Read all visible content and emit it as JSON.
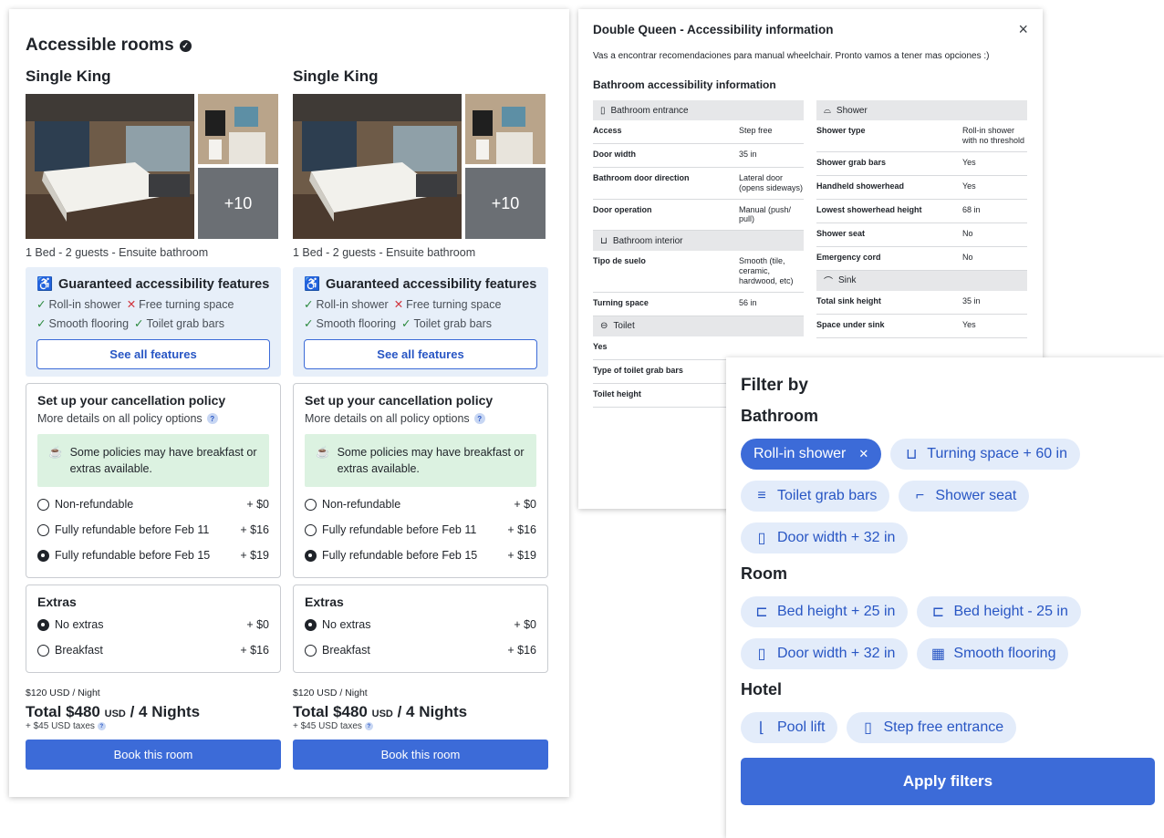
{
  "rooms_panel": {
    "title": "Accessible rooms",
    "rooms": [
      {
        "name": "Single King",
        "more_photos": "+10",
        "subtitle": "1 Bed - 2 guests - Ensuite bathroom",
        "accessibility": {
          "title": "Guaranteed accessibility features",
          "features_row1": [
            {
              "mark": "✓",
              "label": "Roll-in shower",
              "ok": true
            },
            {
              "mark": "✕",
              "label": "Free turning space",
              "ok": false
            }
          ],
          "features_row2": [
            {
              "mark": "✓",
              "label": "Smooth flooring",
              "ok": true
            },
            {
              "mark": "✓",
              "label": "Toilet grab bars",
              "ok": true
            }
          ],
          "button": "See all features"
        },
        "cancellation": {
          "title": "Set up your cancellation policy",
          "subtitle": "More details on all policy options",
          "note": "Some policies may have breakfast or extras available.",
          "options": [
            {
              "label": "Non-refundable",
              "price": "+ $0",
              "selected": false
            },
            {
              "label": "Fully refundable before Feb 11",
              "price": "+ $16",
              "selected": false
            },
            {
              "label": "Fully refundable before Feb 15",
              "price": "+ $19",
              "selected": true
            }
          ]
        },
        "extras": {
          "title": "Extras",
          "options": [
            {
              "label": "No extras",
              "price": "+ $0",
              "selected": true
            },
            {
              "label": "Breakfast",
              "price": "+ $16",
              "selected": false
            }
          ]
        },
        "price_night": "$120 USD / Night",
        "total_amount": "Total $480",
        "total_currency": "USD",
        "total_suffix": "/ 4 Nights",
        "taxes": "+ $45 USD taxes",
        "book": "Book this room"
      },
      {
        "name": "Single King",
        "more_photos": "+10",
        "subtitle": "1 Bed - 2 guests - Ensuite bathroom",
        "accessibility": {
          "title": "Guaranteed accessibility features",
          "features_row1": [
            {
              "mark": "✓",
              "label": "Roll-in shower",
              "ok": true
            },
            {
              "mark": "✕",
              "label": "Free turning space",
              "ok": false
            }
          ],
          "features_row2": [
            {
              "mark": "✓",
              "label": "Smooth flooring",
              "ok": true
            },
            {
              "mark": "✓",
              "label": "Toilet grab bars",
              "ok": true
            }
          ],
          "button": "See all features"
        },
        "cancellation": {
          "title": "Set up your cancellation policy",
          "subtitle": "More details on all policy options",
          "note": "Some policies may have breakfast or extras available.",
          "options": [
            {
              "label": "Non-refundable",
              "price": "+ $0",
              "selected": false
            },
            {
              "label": "Fully refundable before Feb 11",
              "price": "+ $16",
              "selected": false
            },
            {
              "label": "Fully refundable before Feb 15",
              "price": "+ $19",
              "selected": true
            }
          ]
        },
        "extras": {
          "title": "Extras",
          "options": [
            {
              "label": "No extras",
              "price": "+ $0",
              "selected": true
            },
            {
              "label": "Breakfast",
              "price": "+ $16",
              "selected": false
            }
          ]
        },
        "price_night": "$120 USD / Night",
        "total_amount": "Total $480",
        "total_currency": "USD",
        "total_suffix": "/ 4 Nights",
        "taxes": "+ $45 USD taxes",
        "book": "Book this room"
      }
    ]
  },
  "info_panel": {
    "title": "Double Queen - Accessibility information",
    "note": "Vas a encontrar recomendaciones para manual wheelchair. Pronto vamos a tener mas opciones :)",
    "section_title": "Bathroom accessibility information",
    "left_sections": [
      {
        "title": "Bathroom entrance",
        "icon": "door-icon",
        "rows": [
          {
            "k": "Access",
            "v": "Step free"
          },
          {
            "k": "Door width",
            "v": "35 in"
          },
          {
            "k": "Bathroom door direction",
            "v": "Lateral door (opens sideways)"
          },
          {
            "k": "Door operation",
            "v": "Manual (push/ pull)"
          }
        ]
      },
      {
        "title": "Bathroom interior",
        "icon": "turning-space-icon",
        "rows": [
          {
            "k": "Tipo de suelo",
            "v": "Smooth (tile, ceramic, hardwood, etc)"
          },
          {
            "k": "Turning space",
            "v": "56 in"
          }
        ]
      },
      {
        "title": "Toilet",
        "icon": "toilet-icon",
        "rows": [
          {
            "k": "Yes",
            "v": ""
          },
          {
            "k": "Type of toilet grab bars",
            "v": ""
          },
          {
            "k": "Toilet height",
            "v": ""
          }
        ]
      }
    ],
    "right_sections": [
      {
        "title": "Shower",
        "icon": "shower-icon",
        "rows": [
          {
            "k": "Shower type",
            "v": "Roll-in shower with no threshold"
          },
          {
            "k": "Shower grab bars",
            "v": "Yes"
          },
          {
            "k": "Handheld showerhead",
            "v": "Yes"
          },
          {
            "k": "Lowest showerhead height",
            "v": "68 in"
          },
          {
            "k": "Shower seat",
            "v": "No"
          },
          {
            "k": "Emergency cord",
            "v": "No"
          }
        ]
      },
      {
        "title": "Sink",
        "icon": "sink-icon",
        "rows": [
          {
            "k": "Total sink height",
            "v": "35 in"
          },
          {
            "k": "Space under sink",
            "v": "Yes"
          }
        ]
      }
    ]
  },
  "filter_panel": {
    "title": "Filter by",
    "sections": [
      {
        "title": "Bathroom",
        "chips": [
          {
            "label": "Roll-in shower",
            "selected": true,
            "icon": ""
          },
          {
            "label": "Turning space + 60 in",
            "selected": false,
            "icon": "turning-space-icon"
          },
          {
            "label": "Toilet grab bars",
            "selected": false,
            "icon": "grab-bars-icon"
          },
          {
            "label": "Shower seat",
            "selected": false,
            "icon": "shower-seat-icon"
          },
          {
            "label": "Door width + 32 in",
            "selected": false,
            "icon": "door-icon"
          }
        ]
      },
      {
        "title": "Room",
        "chips": [
          {
            "label": "Bed height + 25 in",
            "selected": false,
            "icon": "bed-icon"
          },
          {
            "label": "Bed height - 25 in",
            "selected": false,
            "icon": "bed-icon"
          },
          {
            "label": "Door width + 32 in",
            "selected": false,
            "icon": "door-icon"
          },
          {
            "label": "Smooth flooring",
            "selected": false,
            "icon": "flooring-icon"
          }
        ]
      },
      {
        "title": "Hotel",
        "chips": [
          {
            "label": "Pool lift",
            "selected": false,
            "icon": "pool-lift-icon"
          },
          {
            "label": "Step free entrance",
            "selected": false,
            "icon": "entrance-icon"
          }
        ]
      }
    ],
    "apply": "Apply filters"
  }
}
